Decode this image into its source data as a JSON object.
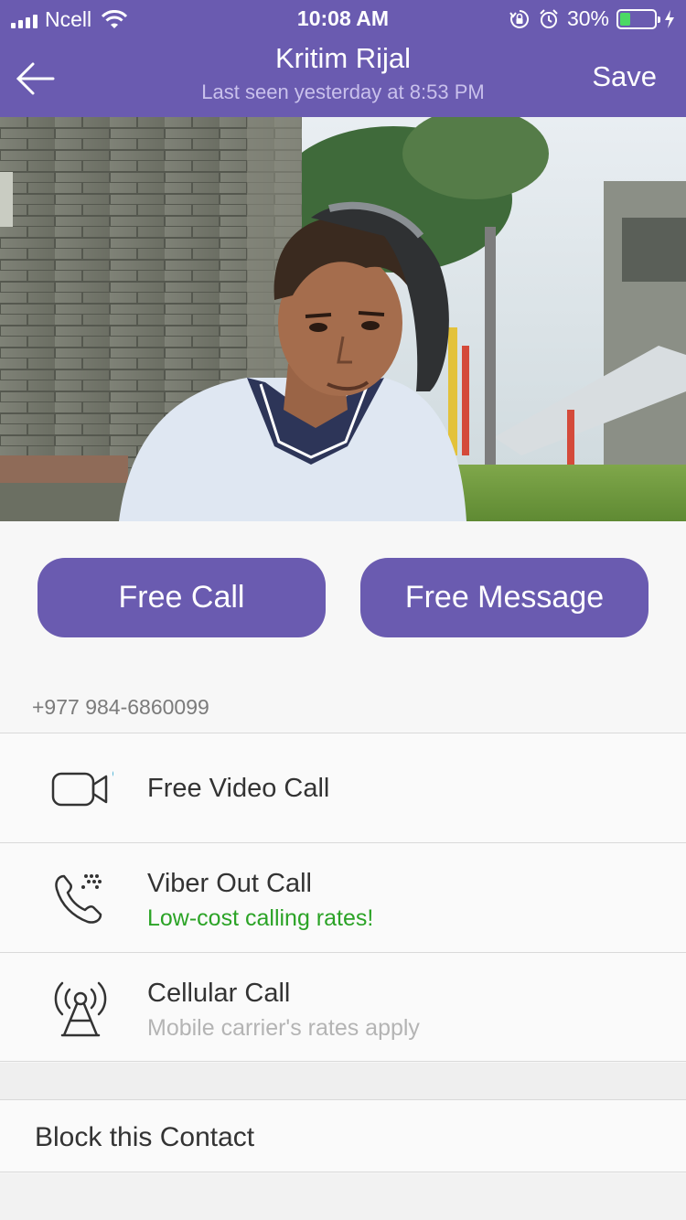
{
  "status_bar": {
    "carrier": "Ncell",
    "time": "10:08 AM",
    "battery_percent": "30%",
    "battery_level": 0.3
  },
  "header": {
    "contact_name": "Kritim Rijal",
    "last_seen": "Last seen yesterday at 8:53 PM",
    "save_label": "Save"
  },
  "actions": {
    "free_call_label": "Free Call",
    "free_message_label": "Free Message"
  },
  "phone_number": "+977 984-6860099",
  "call_options": [
    {
      "title": "Free Video Call",
      "subtitle": "",
      "icon": "video-camera-icon"
    },
    {
      "title": "Viber Out Call",
      "subtitle": "Low-cost calling rates!",
      "icon": "phone-dots-icon"
    },
    {
      "title": "Cellular Call",
      "subtitle": "Mobile carrier's rates apply",
      "icon": "cell-tower-icon"
    }
  ],
  "block_label": "Block this Contact",
  "colors": {
    "brand_purple": "#6a5bb0",
    "green": "#2ba326",
    "dot_blue": "#4db3d6"
  }
}
